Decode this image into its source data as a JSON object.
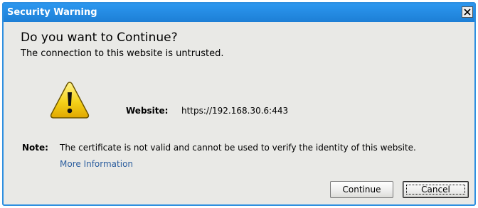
{
  "dialog": {
    "title": "Security Warning",
    "close_symbol": "x",
    "heading": "Do you want to Continue?",
    "subheading": "The connection to this website is untrusted.",
    "icon": "warning-icon",
    "website_label": "Website:",
    "website_value": "https://192.168.30.6:443",
    "note_label": "Note:",
    "note_text": "The certificate is not valid and cannot be used to verify the identity of this website.",
    "more_info_link": "More Information",
    "buttons": {
      "continue_label": "Continue",
      "cancel_label": "Cancel"
    }
  },
  "colors": {
    "titlebar": "#1d7fd6",
    "dialog_background": "#e9e9e6",
    "link": "#2c5e9e",
    "warning_fill": "#f5d21a"
  }
}
